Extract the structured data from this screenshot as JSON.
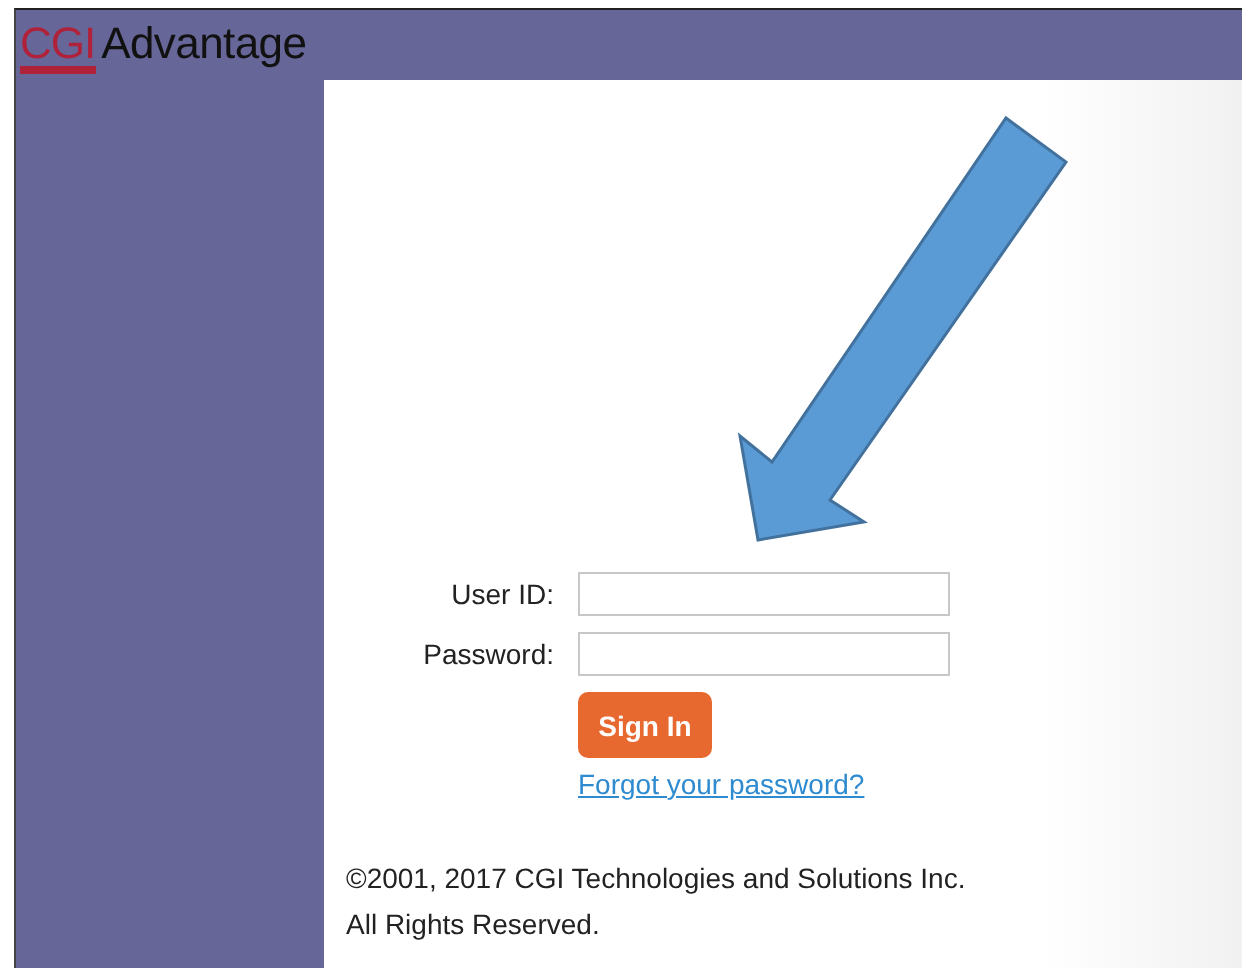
{
  "header": {
    "logo_mark": "CGI",
    "product": "Advantage"
  },
  "login": {
    "fields": [
      {
        "label": "User ID:"
      },
      {
        "label": "Password:"
      }
    ],
    "sign_in_button": "Sign In",
    "forgot_link": "Forgot your password?"
  },
  "copyright": [
    "©2001, 2017 CGI Technologies and Solutions Inc.",
    "All Rights Reserved."
  ]
}
